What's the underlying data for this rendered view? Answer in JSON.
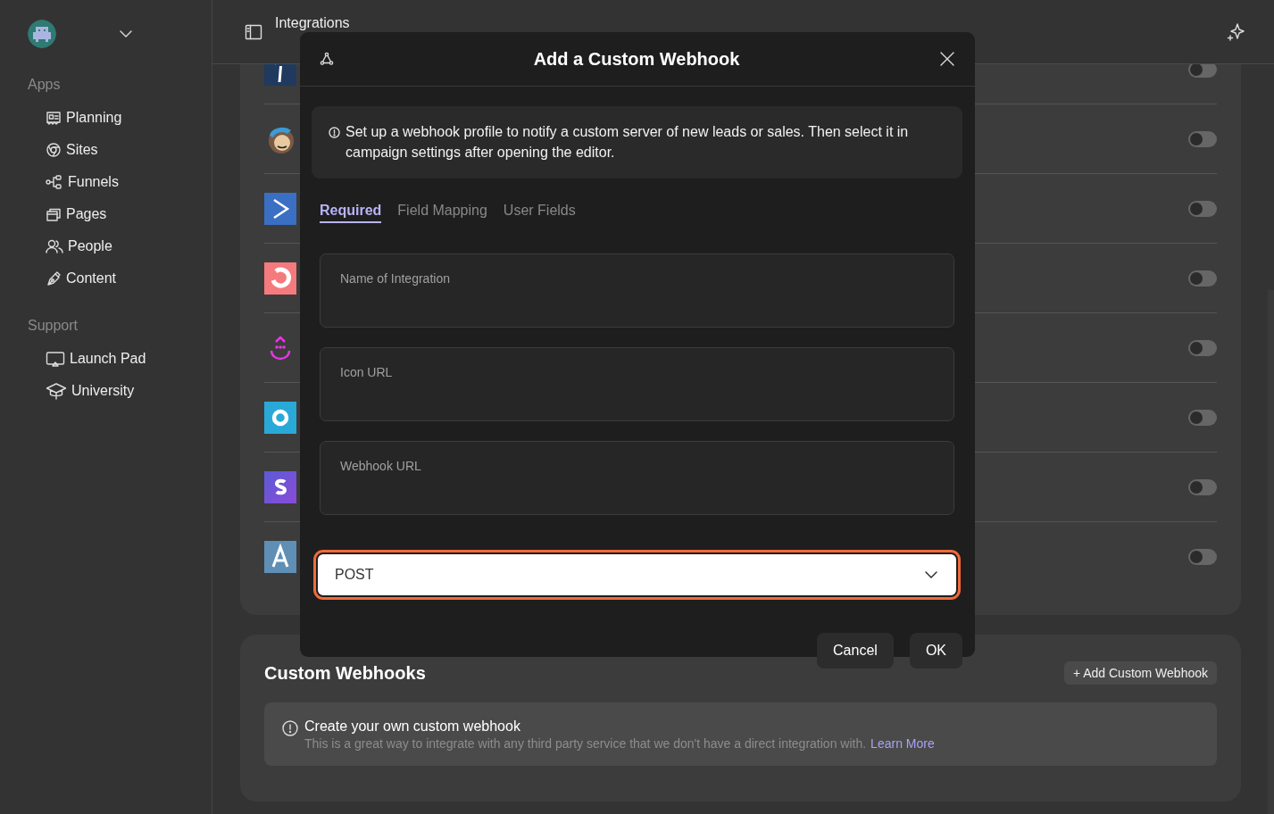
{
  "sidebar": {
    "sections": [
      {
        "title": "Apps",
        "items": [
          {
            "label": "Planning"
          },
          {
            "label": "Sites"
          },
          {
            "label": "Funnels"
          },
          {
            "label": "Pages"
          },
          {
            "label": "People"
          },
          {
            "label": "Content"
          }
        ]
      },
      {
        "title": "Support",
        "items": [
          {
            "label": "Launch Pad"
          },
          {
            "label": "University"
          }
        ]
      }
    ]
  },
  "header": {
    "title": "Integrations"
  },
  "integrations": [
    {
      "on": false
    },
    {
      "on": false
    },
    {
      "on": false
    },
    {
      "on": false
    },
    {
      "on": false
    },
    {
      "on": false
    },
    {
      "on": false
    },
    {
      "on": false
    }
  ],
  "custom_webhooks": {
    "title": "Custom Webhooks",
    "add_button": "+ Add Custom Webhook",
    "info_title": "Create your own custom webhook",
    "info_text": "This is a great way to integrate with any third party service that we don't have a direct integration with.",
    "link": "Learn More"
  },
  "modal": {
    "title": "Add a Custom Webhook",
    "info": "Set up a webhook profile to notify a custom server of new leads or sales. Then select it in campaign settings after opening the editor.",
    "tabs": [
      {
        "label": "Required",
        "selected": true
      },
      {
        "label": "Field Mapping",
        "selected": false
      },
      {
        "label": "User Fields",
        "selected": false
      }
    ],
    "fields": [
      {
        "placeholder": "Name of Integration"
      },
      {
        "placeholder": "Icon URL"
      },
      {
        "placeholder": "Webhook URL"
      }
    ],
    "method": {
      "value": "POST",
      "focused": true
    },
    "buttons": [
      "Cancel",
      "OK"
    ]
  }
}
